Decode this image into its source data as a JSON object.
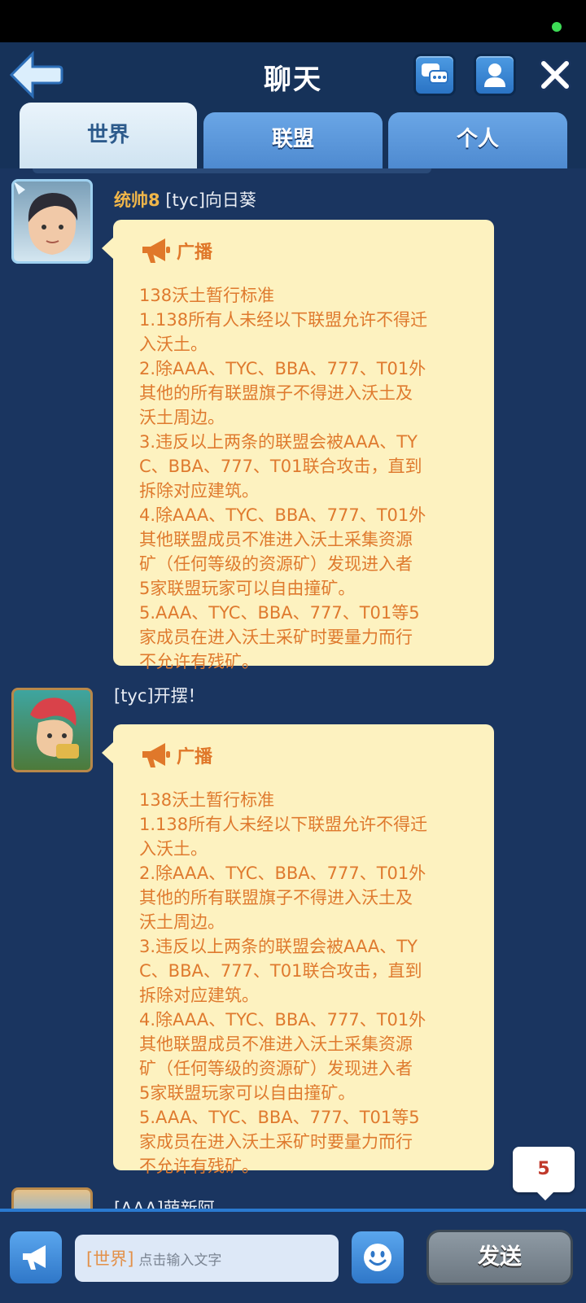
{
  "header": {
    "title": "聊天",
    "icons": {
      "back": "back-arrow-icon",
      "chat": "chat-bubbles-icon",
      "profile": "person-icon",
      "close": "close-x-icon"
    }
  },
  "tabs": [
    {
      "label": "世界",
      "active": true
    },
    {
      "label": "联盟",
      "active": false
    },
    {
      "label": "个人",
      "active": false
    }
  ],
  "messages": [
    {
      "rank": "统帅8",
      "name": "[tyc]向日葵",
      "broadcast_label": "广播",
      "lines": [
        "138沃土暂行标准",
        "1.138所有人未经以下联盟允许不得迁",
        "入沃土。",
        "2.除AAA、TYC、BBA、777、T01外",
        "其他的所有联盟旗子不得进入沃土及",
        "沃土周边。",
        "3.违反以上两条的联盟会被AAA、TY",
        "C、BBA、777、T01联合攻击，直到",
        "拆除对应建筑。",
        "4.除AAA、TYC、BBA、777、T01外",
        "其他联盟成员不准进入沃土采集资源",
        "矿（任何等级的资源矿）发现进入者",
        "5家联盟玩家可以自由撞矿。",
        "5.AAA、TYC、BBA、777、T01等5",
        "家成员在进入沃土采矿时要量力而行",
        "不允许有残矿。"
      ]
    },
    {
      "rank": "",
      "name": "[tyc]开摆！",
      "broadcast_label": "广播",
      "lines": [
        "138沃土暂行标准",
        "1.138所有人未经以下联盟允许不得迁",
        "入沃土。",
        "2.除AAA、TYC、BBA、777、T01外",
        "其他的所有联盟旗子不得进入沃土及",
        "沃土周边。",
        "3.违反以上两条的联盟会被AAA、TY",
        "C、BBA、777、T01联合攻击，直到",
        "拆除对应建筑。",
        "4.除AAA、TYC、BBA、777、T01外",
        "其他联盟成员不准进入沃土采集资源",
        "矿（任何等级的资源矿）发现进入者",
        "5家联盟玩家可以自由撞矿。",
        "5.AAA、TYC、BBA、777、T01等5",
        "家成员在进入沃土采矿时要量力而行",
        "不允许有残矿。"
      ]
    },
    {
      "name": "[AAA]萌新阿"
    }
  ],
  "unread_count": "5",
  "footer": {
    "channel_prefix": "[世界]",
    "input_placeholder": "点击输入文字",
    "send_label": "发送"
  },
  "colors": {
    "background": "#1a3560",
    "bubble": "#fdf2c0",
    "broadcast_text": "#df7a2e",
    "rank": "#f0b64a"
  }
}
